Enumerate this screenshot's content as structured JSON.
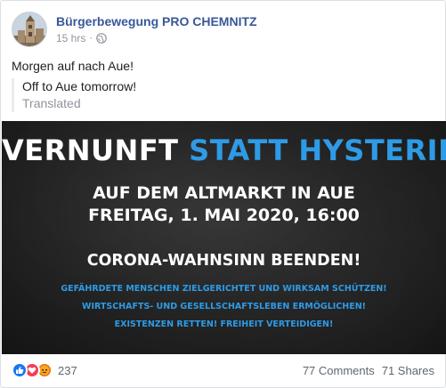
{
  "post": {
    "page_name": "Bürgerbewegung PRO CHEMNITZ",
    "timestamp": "15 hrs",
    "separator": "·",
    "privacy_icon": "globe-icon",
    "avatar_icon": "church-tower-avatar",
    "caption": "Morgen auf nach Aue!",
    "translation": {
      "text": "Off to Aue tomorrow!",
      "label": "Translated"
    }
  },
  "banner": {
    "title_white": "VERNUNFT",
    "title_blue": "STATT HYSTERIE!",
    "place": "AUF DEM ALTMARKT IN AUE",
    "date": "FREITAG, 1. MAI 2020, 16:00",
    "call": "CORONA-WAHNSINN BEENDEN!",
    "line1": "GEFÄHRDETE MENSCHEN ZIELGERICHTET UND WIRKSAM SCHÜTZEN!",
    "line2": "WIRTSCHAFTS- UND GESELLSCHAFTSLEBEN ERMÖGLICHEN!",
    "line3": "EXISTENZEN RETTEN!   FREIHEIT VERTEIDIGEN!",
    "colors": {
      "accent": "#2e9be6",
      "text": "#ffffff",
      "background": "#262626"
    }
  },
  "footer": {
    "reaction_icons": [
      "like-icon",
      "love-icon",
      "angry-icon"
    ],
    "reaction_count": "237",
    "comments": "77 Comments",
    "shares": "71 Shares"
  }
}
